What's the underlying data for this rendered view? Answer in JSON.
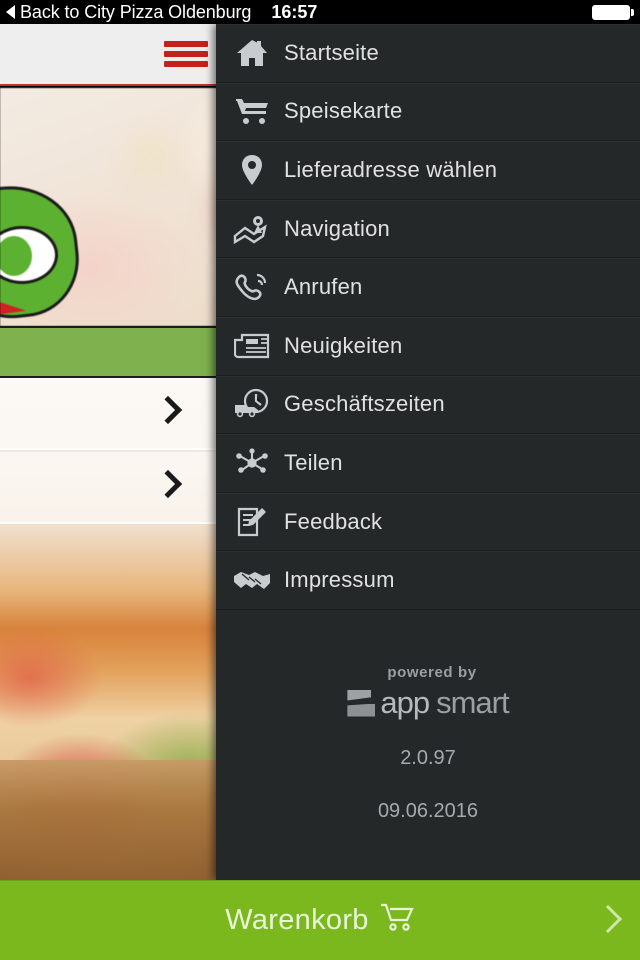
{
  "statusbar": {
    "back_label": "Back to City Pizza Oldenburg",
    "time": "16:57",
    "battery_icon": "battery-full-icon",
    "back_icon": "back-triangle-icon"
  },
  "background_app": {
    "menu_icon": "hamburger-icon",
    "accent_color": "#c4201c",
    "band_color": "#7fb24f",
    "list_rows": [
      {
        "chevron_icon": "chevron-right-icon"
      },
      {
        "chevron_icon": "chevron-right-icon"
      }
    ]
  },
  "drawer": {
    "background_color": "#252829",
    "items": [
      {
        "label": "Startseite",
        "icon": "home-icon"
      },
      {
        "label": "Speisekarte",
        "icon": "shopping-cart-icon"
      },
      {
        "label": "Lieferadresse wählen",
        "icon": "map-pin-icon"
      },
      {
        "label": "Navigation",
        "icon": "map-navigation-icon"
      },
      {
        "label": "Anrufen",
        "icon": "phone-icon"
      },
      {
        "label": "Neuigkeiten",
        "icon": "newspaper-icon"
      },
      {
        "label": "Geschäftszeiten",
        "icon": "delivery-clock-icon"
      },
      {
        "label": "Teilen",
        "icon": "share-nodes-icon"
      },
      {
        "label": "Feedback",
        "icon": "document-pencil-icon"
      },
      {
        "label": "Impressum",
        "icon": "handshake-icon"
      }
    ],
    "footer": {
      "powered_by": "powered by",
      "brand_first": "app",
      "brand_second": "smart",
      "version": "2.0.97",
      "date": "09.06.2016"
    }
  },
  "cart_bar": {
    "label": "Warenkorb",
    "cart_icon": "cart-outline-icon",
    "chevron_icon": "chevron-right-icon",
    "color": "#7ab81e"
  }
}
